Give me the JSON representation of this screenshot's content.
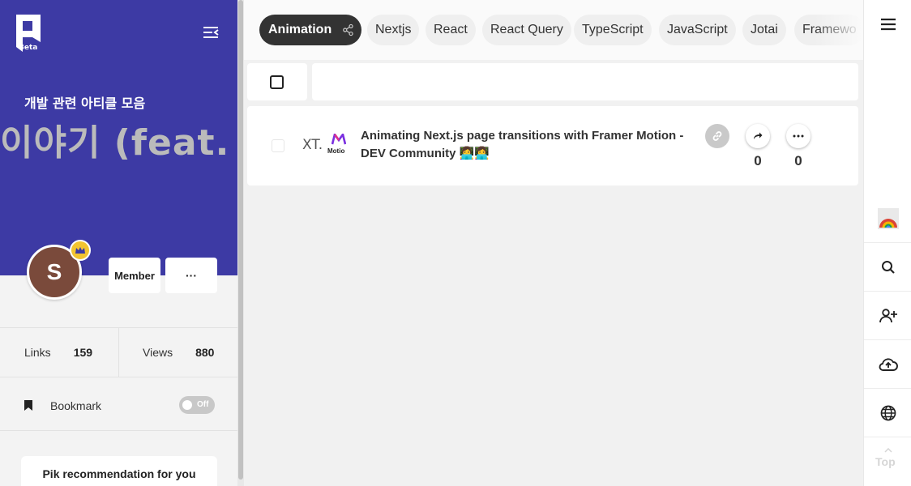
{
  "sidebar": {
    "logo_badge": "Beta",
    "banner_subtitle": "개발 관련 아티클 모음",
    "banner_marquee": "이야기 (feat. Sv",
    "avatar_initial": "S",
    "member_label": "Member",
    "more_label": "···",
    "stats": [
      {
        "label": "Links",
        "value": "159"
      },
      {
        "label": "Views",
        "value": "880"
      }
    ],
    "bookmark_label": "Bookmark",
    "bookmark_toggle": "Off",
    "recommendation_label": "Pik recommendation for you"
  },
  "tabs": [
    {
      "label": "Animation",
      "active": true
    },
    {
      "label": "Nextjs"
    },
    {
      "label": "React"
    },
    {
      "label": "React Query"
    },
    {
      "label": "TypeScript"
    },
    {
      "label": "JavaScript"
    },
    {
      "label": "Jotai"
    },
    {
      "label": "Framewo"
    }
  ],
  "items": [
    {
      "title": "Animating Next.js page transitions with Framer Motion - DEV Community 👩‍💻👩‍💻",
      "thumb_text_left": "XT.",
      "thumb_text_right": "Motio",
      "share_count": "0",
      "comment_count": "0"
    }
  ],
  "rail": {
    "top_label": "Top"
  },
  "colors": {
    "banner": "#3d3aa4",
    "active_tab": "#333333",
    "crown": "#f3c431",
    "avatar": "#7a4a3b"
  }
}
